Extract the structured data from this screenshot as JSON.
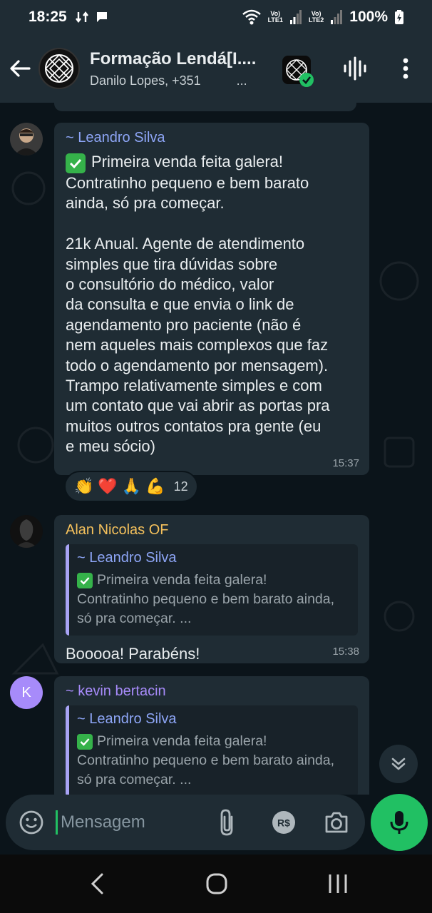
{
  "status_bar": {
    "time": "18:25",
    "sim1": "LTE1",
    "sim2": "LTE2",
    "volte": "Vo)",
    "battery": "100%"
  },
  "header": {
    "title": "Formação Lendá[I....",
    "subtitle": "Danilo Lopes, +351",
    "subtitle_ellipsis": "..."
  },
  "messages": [
    {
      "sender": "~ Leandro Silva",
      "sender_color": "#8ea6f7",
      "first_line": "Primeira venda feita galera!",
      "text": "Contratinho pequeno e bem barato\nainda, só pra começar.\n\n21k Anual. Agente de atendimento\nsimples que tira dúvidas sobre\no consultório do médico, valor\nda consulta e que envia o link de\nagendamento pro paciente (não é\nnem aqueles mais complexos que faz\ntodo o agendamento por mensagem).\nTrampo relativamente simples e com\num contato que vai abrir as portas pra\nmuitos outros contatos pra gente (eu\ne meu sócio)",
      "time": "15:37",
      "reactions": [
        "👏",
        "❤️",
        "🙏",
        "💪"
      ],
      "reaction_count": "12"
    },
    {
      "sender": "Alan Nicolas OF",
      "sender_color": "#f5c15c",
      "quote_sender": "~ Leandro Silva",
      "quote_first_line": "Primeira venda feita galera!",
      "quote_text": "Contratinho pequeno e bem barato ainda, só pra começar. ...",
      "text": "Booooa! Parabéns!",
      "time": "15:38"
    },
    {
      "sender": "~ kevin bertacin",
      "sender_color": "#a78bfa",
      "avatar_letter": "K",
      "quote_sender": "~ Leandro Silva",
      "quote_first_line": "Primeira venda feita galera!",
      "quote_text": "Contratinho pequeno e bem barato ainda, só pra começar. ..."
    }
  ],
  "composer": {
    "placeholder": "Mensagem",
    "currency_label": "R$"
  },
  "colors": {
    "accent": "#21c063",
    "bubble": "#1f2c34",
    "background": "#0b141a"
  },
  "icons": [
    "back-arrow-icon",
    "group-logo-icon",
    "communities-icon",
    "voice-chat-icon",
    "more-vert-icon",
    "emoji-icon",
    "attach-icon",
    "payment-icon",
    "camera-icon",
    "mic-icon",
    "scroll-down-icon",
    "nav-back-icon",
    "nav-home-icon",
    "nav-recents-icon"
  ]
}
